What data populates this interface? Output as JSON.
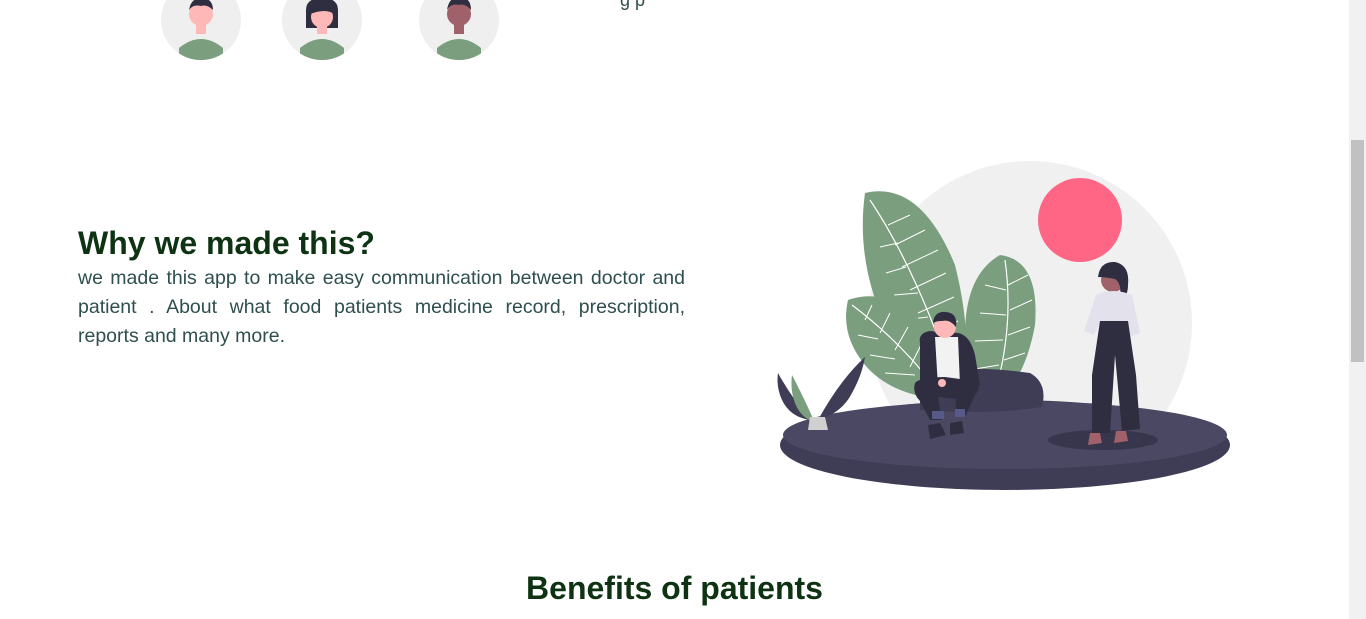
{
  "team": {
    "cut_text": "g   p"
  },
  "why": {
    "heading": "Why we made this?",
    "body": "we made this app to make easy communication between doctor and patient . About what food patients medicine record, prescription, reports and many more."
  },
  "benefits": {
    "heading": "Benefits of patients"
  },
  "colors": {
    "heading": "#0e3313",
    "body_text": "#2f4f4f",
    "accent_circle": "#ff6584",
    "plant": "#7a9e7e",
    "dark": "#3f3d56"
  }
}
